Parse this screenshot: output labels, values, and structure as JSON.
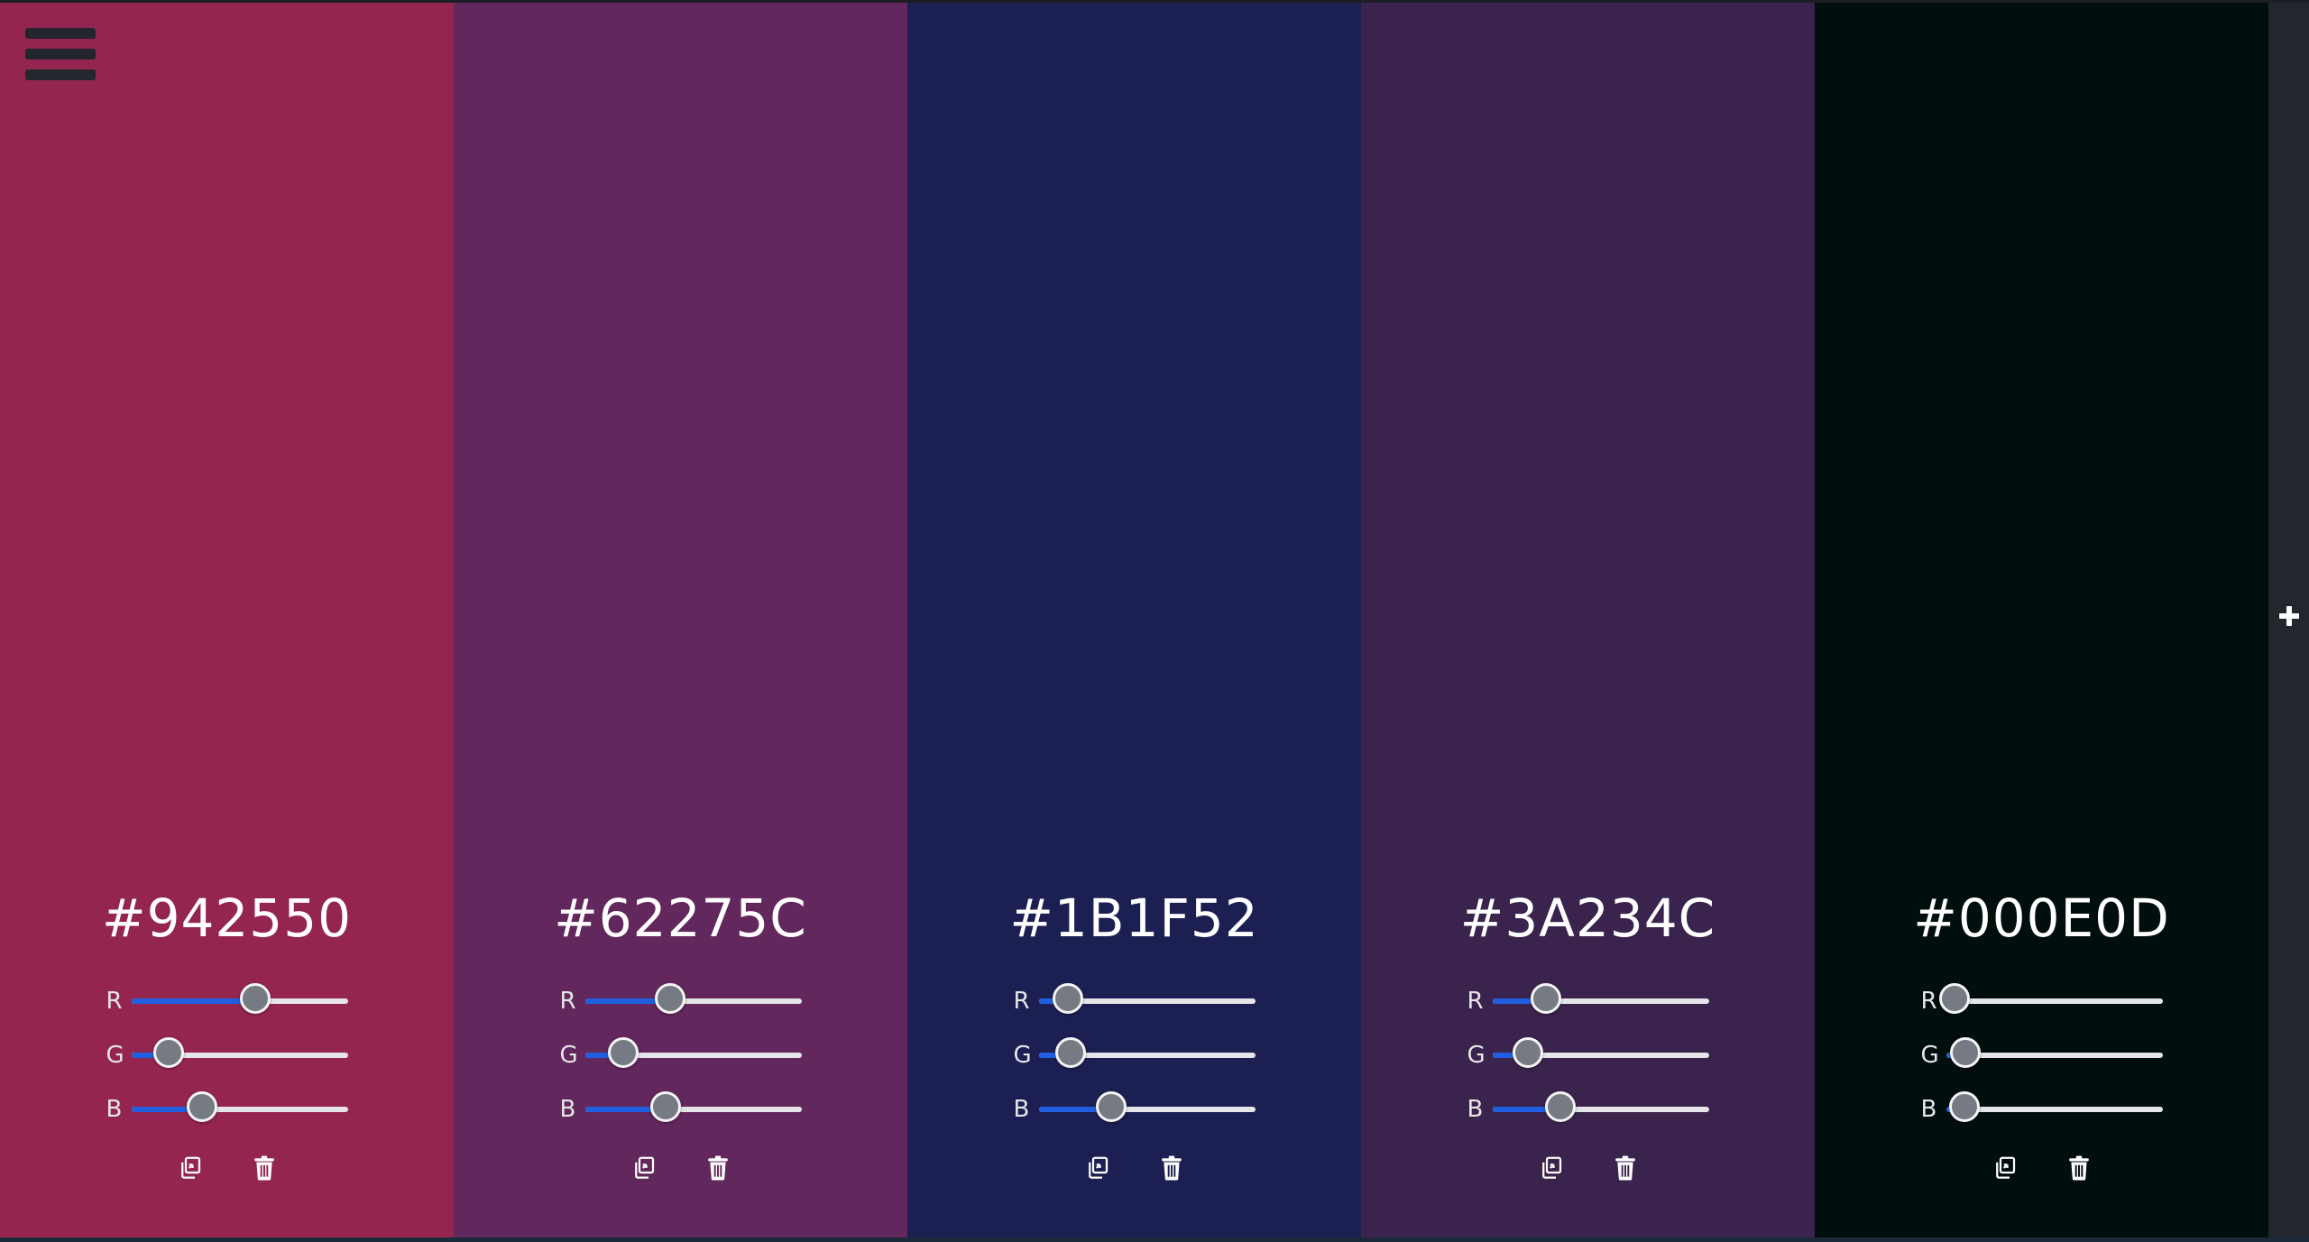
{
  "menu": {
    "icon": "hamburger-menu-icon"
  },
  "add_button": {
    "icon": "plus-icon"
  },
  "swatches": [
    {
      "hex": "#942550",
      "color": "#942550",
      "r": 148,
      "g": 37,
      "b": 80,
      "labels": {
        "r": "R",
        "g": "G",
        "b": "B"
      }
    },
    {
      "hex": "#62275C",
      "color": "#62275C",
      "r": 98,
      "g": 39,
      "b": 92,
      "labels": {
        "r": "R",
        "g": "G",
        "b": "B"
      }
    },
    {
      "hex": "#1B1F52",
      "color": "#1B1F52",
      "r": 27,
      "g": 31,
      "b": 82,
      "labels": {
        "r": "R",
        "g": "G",
        "b": "B"
      }
    },
    {
      "hex": "#3A234C",
      "color": "#3A234C",
      "r": 58,
      "g": 35,
      "b": 76,
      "labels": {
        "r": "R",
        "g": "G",
        "b": "B"
      }
    },
    {
      "hex": "#000E0D",
      "color": "#000E0D",
      "r": 0,
      "g": 14,
      "b": 13,
      "labels": {
        "r": "R",
        "g": "G",
        "b": "B"
      }
    }
  ],
  "colors": {
    "slider_fill": "#1f5fe0",
    "slider_track": "#e5e5ea",
    "rail": "#23262c"
  }
}
